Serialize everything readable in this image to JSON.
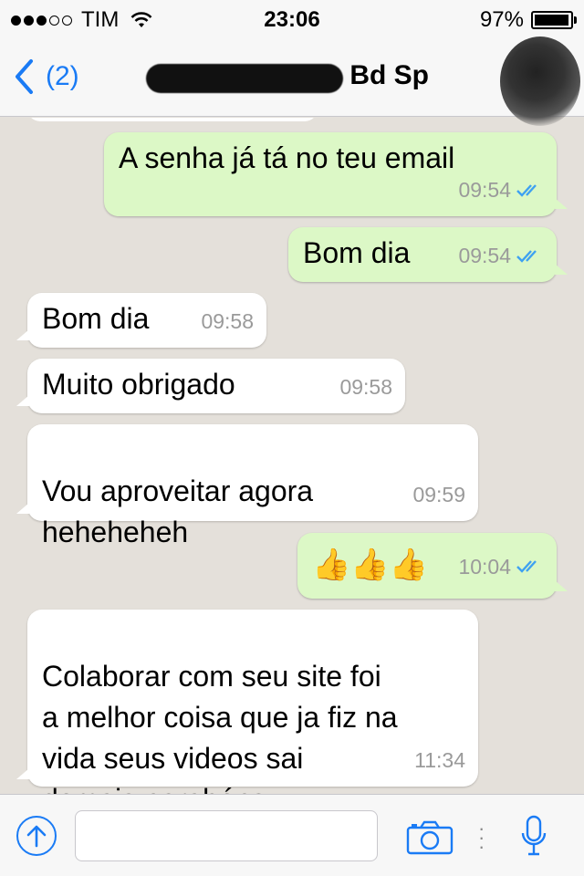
{
  "status_bar": {
    "carrier": "TIM",
    "time": "23:06",
    "battery": "97%",
    "battery_level": 0.97
  },
  "nav": {
    "back_label": "(2)",
    "title": "Bd Sp"
  },
  "messages": [
    {
      "dir": "out",
      "text": "A senha já tá no teu email",
      "time": "09:54"
    },
    {
      "dir": "out",
      "text": "Bom dia",
      "time": "09:54"
    },
    {
      "dir": "in",
      "text": "Bom dia",
      "time": "09:58"
    },
    {
      "dir": "in",
      "text": "Muito obrigado",
      "time": "09:58"
    },
    {
      "dir": "in",
      "text": "Vou aproveitar agora\nheheheheh",
      "time": "09:59"
    },
    {
      "dir": "out",
      "text": "👍👍👍",
      "time": "10:04"
    },
    {
      "dir": "in",
      "text": "Colaborar com seu site foi\na melhor coisa que ja fiz na\nvida seus videos sai\ndemais parabéns",
      "time": "11:34"
    }
  ],
  "input": {
    "placeholder": ""
  },
  "icons": {
    "back": "chevron-left-icon",
    "attach": "upload-icon",
    "camera": "camera-icon",
    "mic": "microphone-icon",
    "read": "double-check-icon"
  },
  "colors": {
    "accent": "#1a7bf5",
    "outgoing": "#dcf8c6",
    "incoming": "#ffffff",
    "background": "#e4e0da"
  }
}
